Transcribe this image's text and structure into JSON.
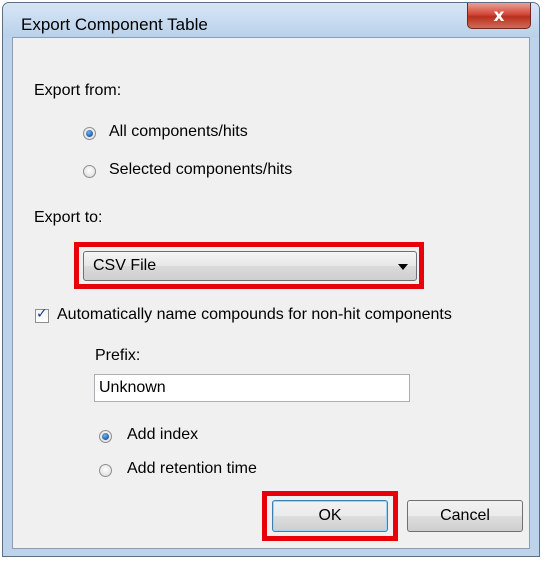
{
  "window": {
    "title": "Export Component Table",
    "close_glyph": "x"
  },
  "export_from": {
    "label": "Export from:",
    "options": [
      {
        "label": "All components/hits",
        "selected": true
      },
      {
        "label": "Selected components/hits",
        "selected": false
      }
    ]
  },
  "export_to": {
    "label": "Export to:",
    "selected_value": "CSV File"
  },
  "auto_name": {
    "checked": true,
    "check_glyph": "✓",
    "label": "Automatically name compounds for non-hit components",
    "prefix_label": "Prefix:",
    "prefix_value": "Unknown",
    "options": [
      {
        "label": "Add index",
        "selected": true
      },
      {
        "label": "Add retention time",
        "selected": false
      }
    ]
  },
  "buttons": {
    "ok_label": "OK",
    "cancel_label": "Cancel"
  },
  "colors": {
    "highlight": "#e8000a",
    "titlebar": "#bcd3ea",
    "close_button": "#d2493a"
  }
}
